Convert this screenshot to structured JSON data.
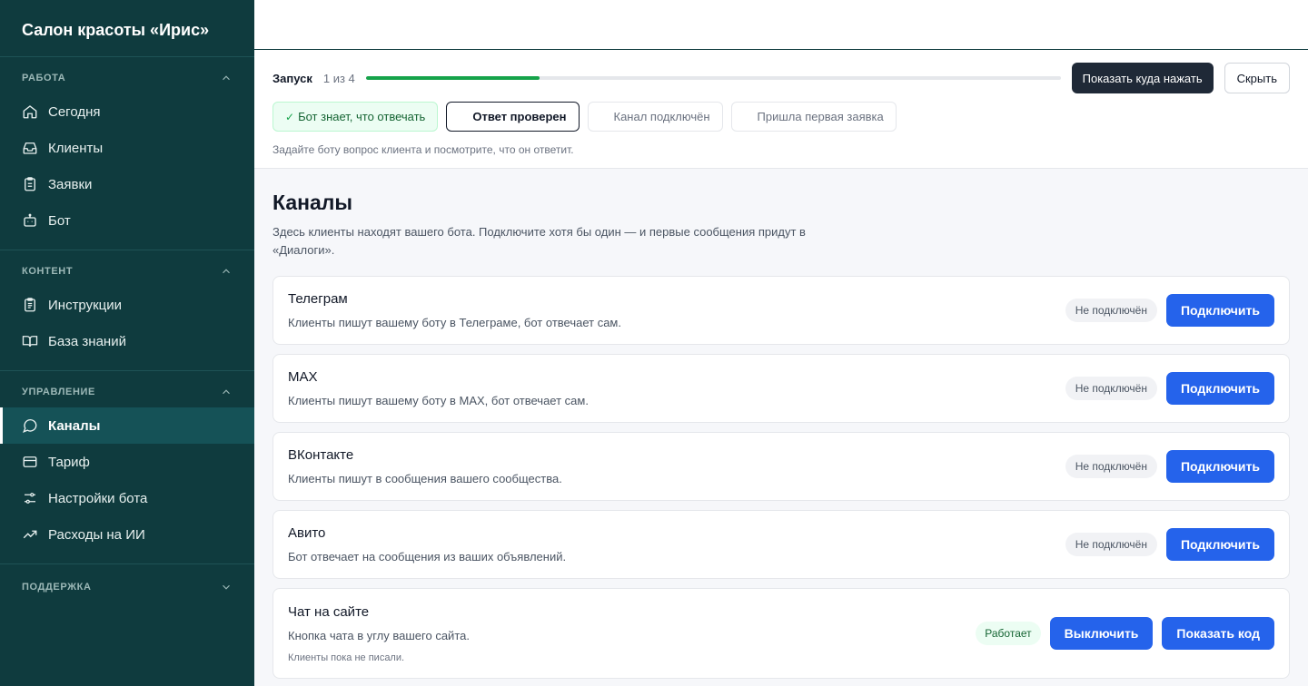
{
  "sidebar": {
    "brand": "Салон красоты «Ирис»",
    "sections": [
      {
        "title": "РАБОТА",
        "items": [
          "Сегодня",
          "Клиенты",
          "Заявки",
          "Бот"
        ]
      },
      {
        "title": "КОНТЕНТ",
        "items": [
          "Инструкции",
          "База знаний"
        ]
      },
      {
        "title": "УПРАВЛЕНИЕ",
        "items": [
          "Каналы",
          "Тариф",
          "Настройки бота",
          "Расходы на ИИ"
        ]
      },
      {
        "title": "ПОДДЕРЖКА",
        "items": []
      }
    ],
    "active_item": "Каналы"
  },
  "onboarding": {
    "title": "Запуск",
    "count": "1 из 4",
    "progress": 0.25,
    "show_button": "Показать куда нажать",
    "hide_button": "Скрыть",
    "steps": [
      {
        "label": "Бот знает, что отвечать",
        "state": "done"
      },
      {
        "label": "Ответ проверен",
        "state": "current"
      },
      {
        "label": "Канал подключён",
        "state": "pending"
      },
      {
        "label": "Пришла первая заявка",
        "state": "pending"
      }
    ],
    "hint": "Задайте боту вопрос клиента и посмотрите, что он ответит."
  },
  "page": {
    "title": "Каналы",
    "description": "Здесь клиенты находят вашего бота. Подключите хотя бы один — и первые сообщения придут в «Диалоги»."
  },
  "channels": [
    {
      "name": "Телеграм",
      "description": "Клиенты пишут вашему боту в Телеграме, бот отвечает сам.",
      "status": "Не подключён",
      "action": "Подключить"
    },
    {
      "name": "MAX",
      "description": "Клиенты пишут вашему боту в MAX, бот отвечает сам.",
      "status": "Не подключён",
      "action": "Подключить"
    },
    {
      "name": "ВКонтакте",
      "description": "Клиенты пишут в сообщения вашего сообщества.",
      "status": "Не подключён",
      "action": "Подключить"
    },
    {
      "name": "Авито",
      "description": "Бот отвечает на сообщения из ваших объявлений.",
      "status": "Не подключён",
      "action": "Подключить"
    },
    {
      "name": "Чат на сайте",
      "description": "Кнопка чата в углу вашего сайта.",
      "note": "Клиенты пока не писали.",
      "status": "Работает",
      "action": "Выключить",
      "action2": "Показать код"
    }
  ],
  "colors": {
    "sidebar_bg": "#0f3b3e",
    "sidebar_active": "#155257",
    "primary": "#2563eb",
    "progress": "#16a34a",
    "dark_button": "#1f2937"
  }
}
